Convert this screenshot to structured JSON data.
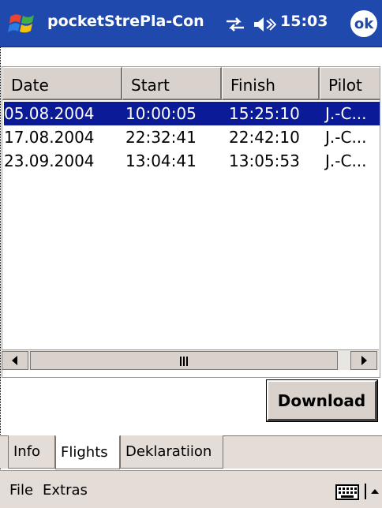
{
  "titlebar": {
    "app_title": "pocketStrePla-Con",
    "clock": "15:03",
    "ok_label": "ok",
    "icons": [
      "windows-start-icon",
      "connectivity-icon",
      "volume-icon"
    ]
  },
  "table": {
    "columns": [
      "Date",
      "Start",
      "Finish",
      "Pilot"
    ],
    "rows": [
      {
        "date": "05.08.2004",
        "start": "10:00:05",
        "finish": "15:25:10",
        "pilot": "J.-C..."
      },
      {
        "date": "17.08.2004",
        "start": "22:32:41",
        "finish": "22:42:10",
        "pilot": "J.-C..."
      },
      {
        "date": "23.09.2004",
        "start": "13:04:41",
        "finish": "13:05:53",
        "pilot": "J.-C..."
      }
    ],
    "selected_row": 0
  },
  "download_label": "Download",
  "tabs": [
    "Info",
    "Flights",
    "Deklaratiion"
  ],
  "active_tab": "Flights",
  "menu": {
    "file": "File",
    "extras": "Extras"
  },
  "colors": {
    "titlebar": "#1f49ad",
    "selection": "#0b1a96",
    "chrome": "#d9d2cc"
  }
}
